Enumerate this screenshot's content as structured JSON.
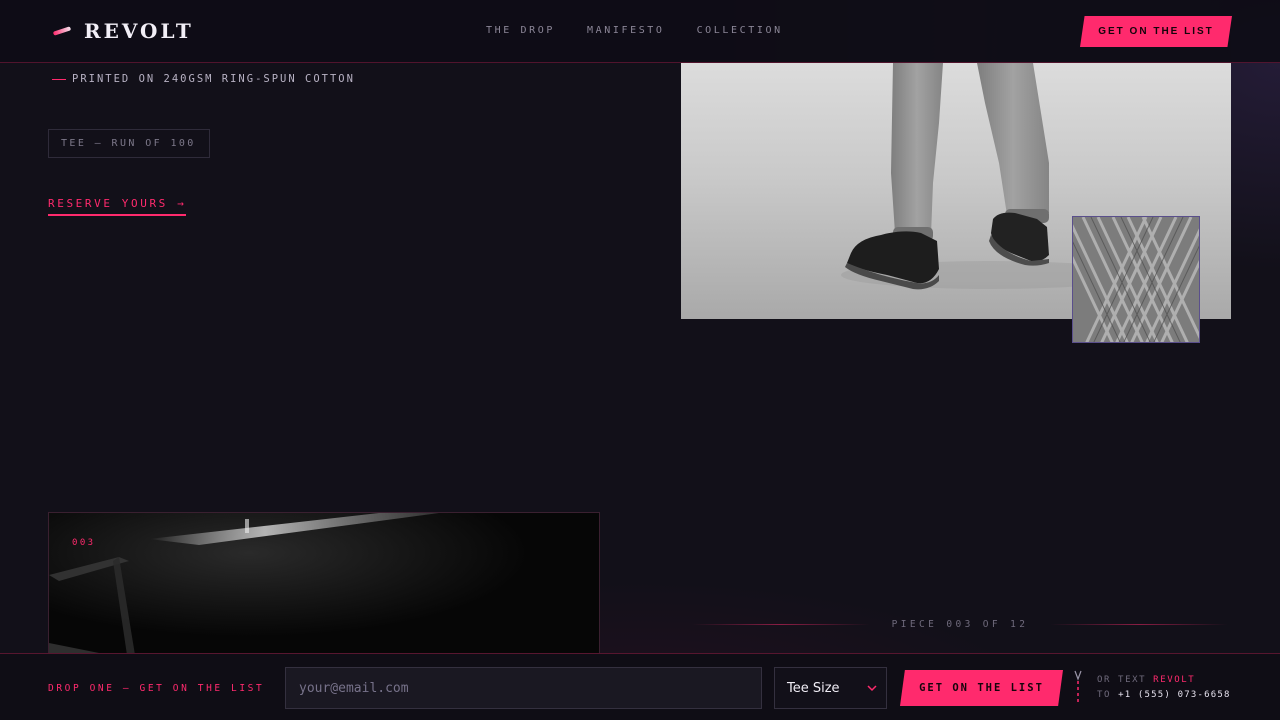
{
  "header": {
    "logo_text": "REVOLT",
    "logo_icon": "slash-mark-icon",
    "nav": [
      {
        "label": "THE DROP"
      },
      {
        "label": "MANIFESTO"
      },
      {
        "label": "COLLECTION"
      }
    ],
    "cta_label": "GET ON THE LIST"
  },
  "hero": {
    "tagline": "PRINTED ON 240GSM RING-SPUN COTTON",
    "badge": "TEE — RUN OF 100",
    "reserve_link": "RESERVE YOURS →",
    "main_image": "legs-walking-sneakers-photo",
    "swatch_image": "fabric-weave-closeup"
  },
  "secondary_photo": {
    "number": "003"
  },
  "piece_counter": "PIECE 003 OF 12",
  "signup_bar": {
    "label": "DROP ONE — GET ON THE LIST",
    "email_placeholder": "your@email.com",
    "email_value": "",
    "size_selected": "Tee Size",
    "submit_label": "GET ON THE LIST",
    "sms_prefix": "OR TEXT",
    "sms_keyword": "REVOLT",
    "sms_to": "TO",
    "sms_number": "+1 (555) 073-6658"
  },
  "colors": {
    "accent": "#ff2a6d",
    "background": "#121019",
    "text": "#cfcad8"
  }
}
